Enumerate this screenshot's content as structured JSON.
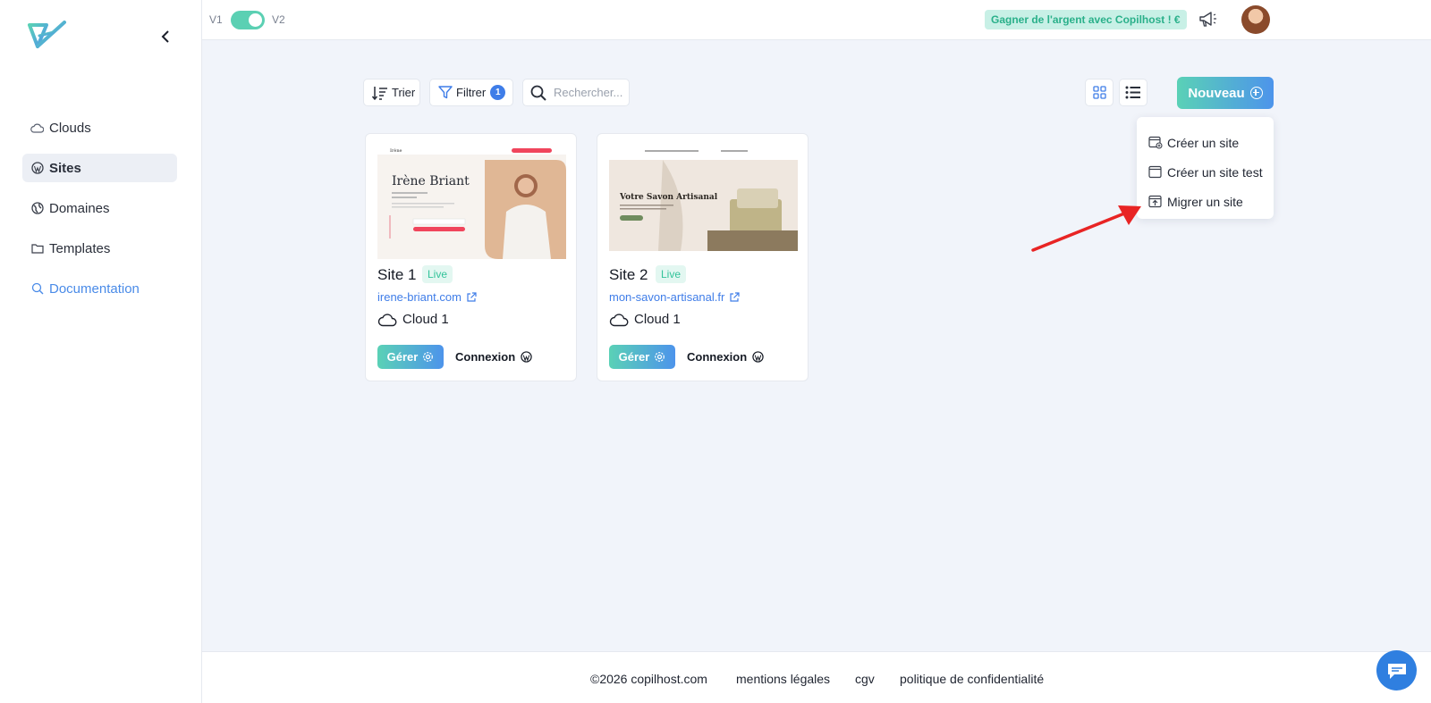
{
  "topbar": {
    "v1_label": "V1",
    "v2_label": "V2",
    "promo": "Gagner de l'argent avec Copilhost ! €",
    "colors": {
      "accent": "#5bd0b3",
      "promo_bg": "#c8f0e6"
    }
  },
  "sidebar": {
    "items": [
      {
        "label": "Clouds",
        "icon": "cloud-icon"
      },
      {
        "label": "Sites",
        "icon": "wordpress-icon",
        "active": true
      },
      {
        "label": "Domaines",
        "icon": "globe-icon"
      },
      {
        "label": "Templates",
        "icon": "folder-icon"
      },
      {
        "label": "Documentation",
        "icon": "search-icon"
      }
    ]
  },
  "toolbar": {
    "sort_label": "Trier",
    "filter_label": "Filtrer",
    "filter_count": "1",
    "search_placeholder": "Rechercher...",
    "new_label": "Nouveau"
  },
  "dropdown": {
    "items": [
      {
        "label": "Créer un site",
        "icon": "calendar-add-icon"
      },
      {
        "label": "Créer un site test",
        "icon": "window-icon"
      },
      {
        "label": "Migrer un site",
        "icon": "upload-box-icon"
      }
    ]
  },
  "sites": [
    {
      "title": "Site 1",
      "status": "Live",
      "url": "irene-briant.com",
      "cloud": "Cloud 1",
      "manage_label": "Gérer",
      "login_label": "Connexion",
      "thumb": {
        "heading": "Irène Briant",
        "brand": "Irène"
      }
    },
    {
      "title": "Site 2",
      "status": "Live",
      "url": "mon-savon-artisanal.fr",
      "cloud": "Cloud 1",
      "manage_label": "Gérer",
      "login_label": "Connexion",
      "thumb": {
        "heading": "Votre Savon Artisanal"
      }
    }
  ],
  "footer": {
    "copyright": "©2026 copilhost.com",
    "legal": "mentions légales",
    "cgv": "cgv",
    "privacy": "politique de confidentialité"
  }
}
